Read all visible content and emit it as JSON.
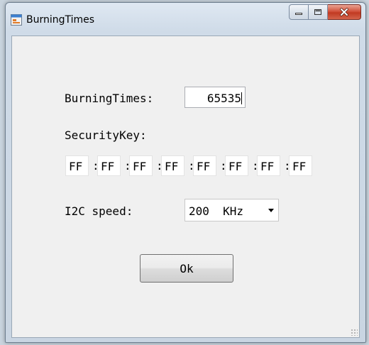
{
  "window": {
    "title": "BurningTimes",
    "controls": {
      "minimize_icon": "minimize-icon",
      "maximize_icon": "maximize-icon",
      "close_icon": "close-icon"
    }
  },
  "form": {
    "burning_times_label": "BurningTimes:",
    "burning_times_value": "65535",
    "security_key_label": "SecurityKey:",
    "security_key_bytes": [
      "FF",
      "FF",
      "FF",
      "FF",
      "FF",
      "FF",
      "FF",
      "FF"
    ],
    "separator": ":",
    "i2c_speed_label": "I2C speed:",
    "i2c_speed_value": "200  KHz",
    "ok_label": "Ok"
  },
  "colors": {
    "close_button": "#c9452c",
    "client_background": "#f0f0f0"
  }
}
